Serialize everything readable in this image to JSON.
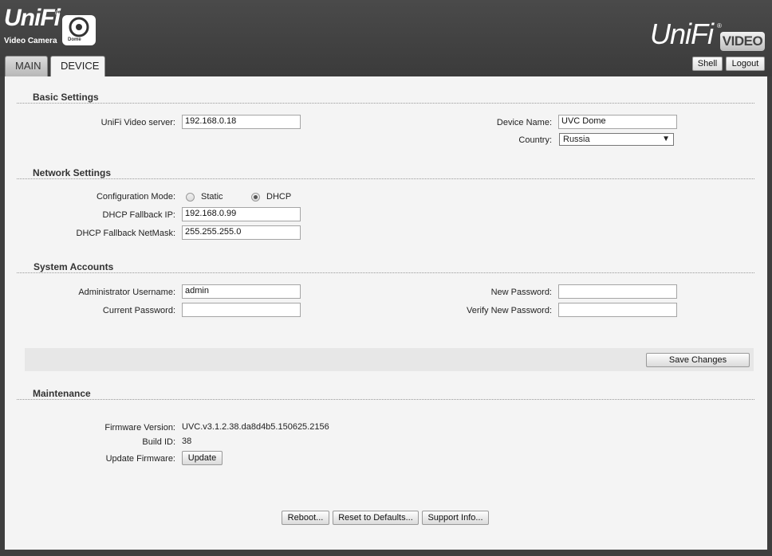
{
  "header": {
    "logo_left_word": "UniFi",
    "logo_left_sub": "Video Camera",
    "logo_left_model": "Dome",
    "logo_right_word": "UniFi",
    "logo_right_badge": "VIDEO",
    "tabs": [
      {
        "label": "MAIN"
      },
      {
        "label": "DEVICE"
      }
    ],
    "shell_label": "Shell",
    "logout_label": "Logout"
  },
  "basic": {
    "title": "Basic Settings",
    "server_label": "UniFi Video server:",
    "server_value": "192.168.0.18",
    "device_name_label": "Device Name:",
    "device_name_value": "UVC Dome",
    "country_label": "Country:",
    "country_value": "Russia"
  },
  "network": {
    "title": "Network Settings",
    "config_mode_label": "Configuration Mode:",
    "static_label": "Static",
    "dhcp_label": "DHCP",
    "selected_mode": "DHCP",
    "fallback_ip_label": "DHCP Fallback IP:",
    "fallback_ip_value": "192.168.0.99",
    "fallback_mask_label": "DHCP Fallback NetMask:",
    "fallback_mask_value": "255.255.255.0"
  },
  "accounts": {
    "title": "System Accounts",
    "admin_user_label": "Administrator Username:",
    "admin_user_value": "admin",
    "current_pw_label": "Current Password:",
    "current_pw_value": "",
    "new_pw_label": "New Password:",
    "new_pw_value": "",
    "verify_pw_label": "Verify New Password:",
    "verify_pw_value": ""
  },
  "save_label": "Save Changes",
  "maintenance": {
    "title": "Maintenance",
    "fw_version_label": "Firmware Version:",
    "fw_version_value": "UVC.v3.1.2.38.da8d4b5.150625.2156",
    "build_id_label": "Build ID:",
    "build_id_value": "38",
    "update_fw_label": "Update Firmware:",
    "update_button": "Update"
  },
  "footer": {
    "reboot": "Reboot...",
    "reset": "Reset to Defaults...",
    "support": "Support Info..."
  }
}
